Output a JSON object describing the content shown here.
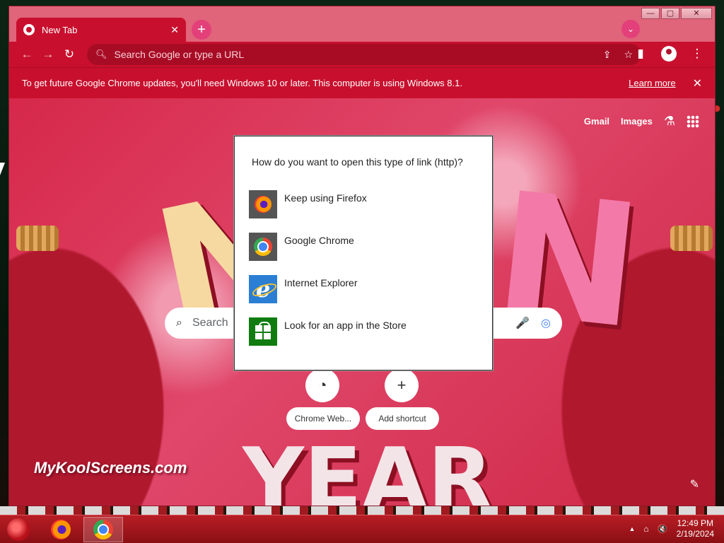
{
  "browser": {
    "tab_title": "New Tab",
    "tab_close": "✕",
    "new_tab": "+",
    "tab_search": "⌄",
    "window_controls": {
      "minimize": "—",
      "maximize": "▢",
      "close": "✕"
    },
    "omnibox_placeholder": "Search Google or type a URL",
    "nav": {
      "back": "←",
      "forward": "→",
      "reload": "↻"
    },
    "omnibox_icons": {
      "share": "⇪",
      "bookmark": "☆"
    },
    "toolbar_icons": {
      "side_panel": "▮",
      "menu": "⋮"
    }
  },
  "infobar": {
    "message": "To get future Google Chrome updates, you'll need Windows 10 or later. This computer is using Windows 8.1.",
    "learn_more": "Learn more",
    "dismiss": "✕"
  },
  "ntp": {
    "gmail": "Gmail",
    "images": "Images",
    "labs": "⚗",
    "search_placeholder": "Search",
    "search_icon": "⌕",
    "mic_icon": "🎤",
    "lens_icon": "◎",
    "shortcuts": [
      {
        "label": "Chrome Web...",
        "icon": "◔"
      },
      {
        "label": "Add shortcut",
        "icon": "+"
      }
    ],
    "watermark": "MyKoolScreens.com",
    "edit_icon": "✎"
  },
  "dialog": {
    "title": "How do you want to open this type of link (http)?",
    "options": [
      {
        "name": "Keep using Firefox",
        "icon": "firefox-icon"
      },
      {
        "name": "Google Chrome",
        "icon": "chrome-icon"
      },
      {
        "name": "Internet Explorer",
        "icon": "internet-explorer-icon"
      },
      {
        "name": "Look for an app in the Store",
        "icon": "store-icon"
      }
    ]
  },
  "taskbar": {
    "time": "12:49 PM",
    "date": "2/19/2024",
    "tray_up": "▲",
    "tray_network": "⌂",
    "tray_volume": "🔇"
  },
  "colors": {
    "theme_red": "#c8102e",
    "tab_strip": "#e0647a",
    "taskbar_red": "#b81d24"
  }
}
